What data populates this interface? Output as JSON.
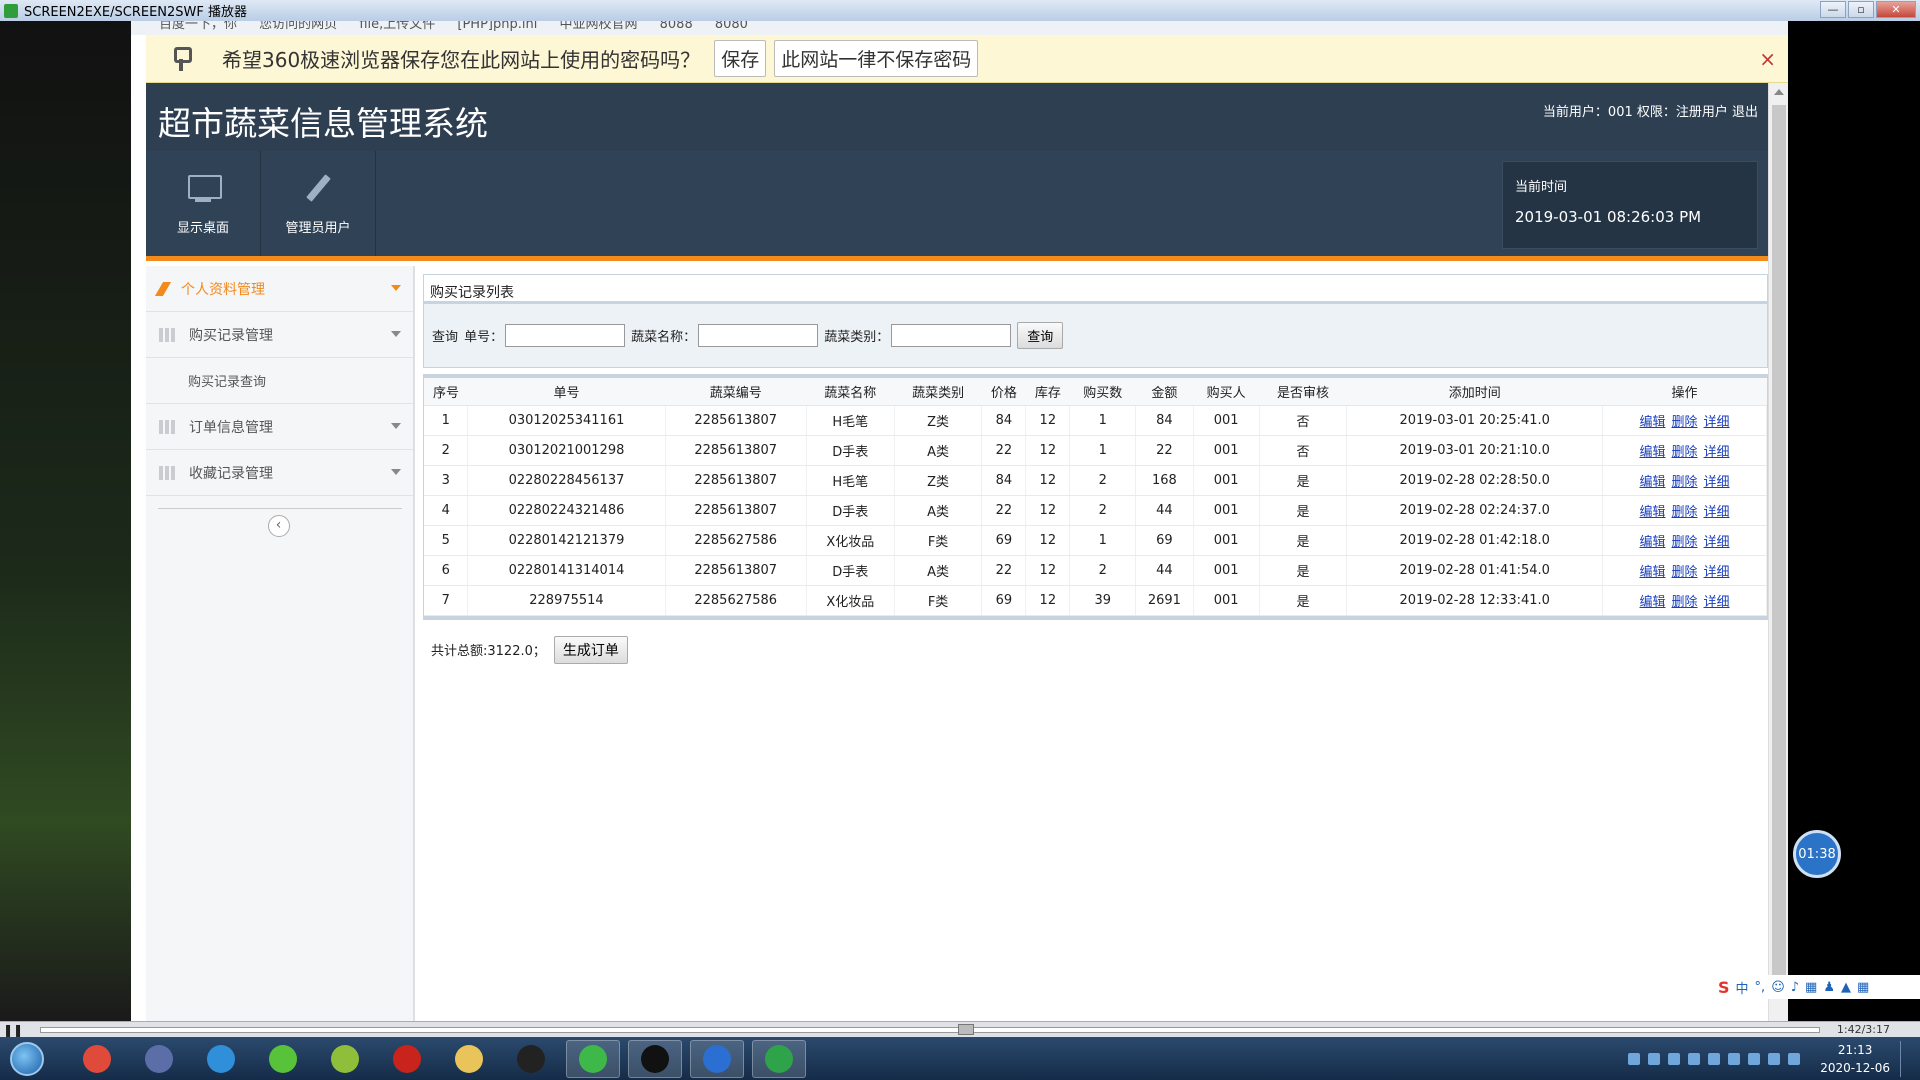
{
  "player": {
    "title": "SCREEN2EXE/SCREEN2SWF 播放器",
    "elapsed": "1:42/3:17",
    "timer_bubble": "01:38"
  },
  "browser": {
    "bookmarks": [
      "百度一下，你",
      "您访问的网页",
      "file,上传文件",
      "[PHP]php.ini",
      "中亚网校官网",
      "8088",
      "8080"
    ],
    "password_bar": {
      "message": "希望360极速浏览器保存您在此网站上使用的密码吗？",
      "save_label": "保存",
      "never_label": "此网站一律不保存密码",
      "close_label": "×"
    }
  },
  "app": {
    "title": "超市蔬菜信息管理系统",
    "user_info": "当前用户：001 权限：注册用户 退出",
    "nav": [
      {
        "label": "显示桌面",
        "icon": "monitor-icon"
      },
      {
        "label": "管理员用户",
        "icon": "pencil-icon"
      }
    ],
    "clock": {
      "label": "当前时间",
      "time": "2019-03-01 08:26:03 PM"
    },
    "accent_color": "#f28a1c",
    "header_color": "#2e3f52"
  },
  "sidebar": {
    "items": [
      {
        "label": "个人资料管理"
      },
      {
        "label": "购买记录管理"
      },
      {
        "label": "订单信息管理"
      },
      {
        "label": "收藏记录管理"
      }
    ],
    "sub_item": "购买记录查询",
    "collapse_glyph": "‹"
  },
  "main": {
    "list_title": "购买记录列表",
    "query": {
      "prefix": "查询",
      "order_label": "单号：",
      "name_label": "蔬菜名称：",
      "category_label": "蔬菜类别：",
      "button": "查询"
    },
    "columns": [
      "序号",
      "单号",
      "蔬菜编号",
      "蔬菜名称",
      "蔬菜类别",
      "价格",
      "库存",
      "购买数",
      "金额",
      "购买人",
      "是否审核",
      "添加时间",
      "操作"
    ],
    "rows": [
      [
        "1",
        "03012025341161",
        "2285613807",
        "H毛笔",
        "Z类",
        "84",
        "12",
        "1",
        "84",
        "001",
        "否",
        "2019-03-01 20:25:41.0"
      ],
      [
        "2",
        "03012021001298",
        "2285613807",
        "D手表",
        "A类",
        "22",
        "12",
        "1",
        "22",
        "001",
        "否",
        "2019-03-01 20:21:10.0"
      ],
      [
        "3",
        "02280228456137",
        "2285613807",
        "H毛笔",
        "Z类",
        "84",
        "12",
        "2",
        "168",
        "001",
        "是",
        "2019-02-28 02:28:50.0"
      ],
      [
        "4",
        "02280224321486",
        "2285613807",
        "D手表",
        "A类",
        "22",
        "12",
        "2",
        "44",
        "001",
        "是",
        "2019-02-28 02:24:37.0"
      ],
      [
        "5",
        "02280142121379",
        "2285627586",
        "X化妆品",
        "F类",
        "69",
        "12",
        "1",
        "69",
        "001",
        "是",
        "2019-02-28 01:42:18.0"
      ],
      [
        "6",
        "02280141314014",
        "2285613807",
        "D手表",
        "A类",
        "22",
        "12",
        "2",
        "44",
        "001",
        "是",
        "2019-02-28 01:41:54.0"
      ],
      [
        "7",
        "228975514",
        "2285627586",
        "X化妆品",
        "F类",
        "69",
        "12",
        "39",
        "2691",
        "001",
        "是",
        "2019-02-28 12:33:41.0"
      ]
    ],
    "actions": [
      "编辑",
      "删除",
      "详细"
    ],
    "total_text": "共计总额:3122.0；",
    "generate_button": "生成订单"
  },
  "ime": {
    "logo": "S",
    "mode": "中"
  },
  "taskbar": {
    "apps": [
      {
        "name": "chrome",
        "color": "#e04a3a"
      },
      {
        "name": "player",
        "color": "#5b6ea8"
      },
      {
        "name": "browser-360",
        "color": "#2f8fd8"
      },
      {
        "name": "leaf",
        "color": "#58c33a"
      },
      {
        "name": "editor",
        "color": "#8fbf3a"
      },
      {
        "name": "flash",
        "color": "#c8241c"
      },
      {
        "name": "explorer",
        "color": "#e8c45a"
      },
      {
        "name": "qq",
        "color": "#222222"
      },
      {
        "name": "wechat",
        "color": "#3fb84a"
      },
      {
        "name": "recorder",
        "color": "#111111"
      },
      {
        "name": "word",
        "color": "#2a6fd1"
      },
      {
        "name": "screen2swf",
        "color": "#2ea34a"
      }
    ],
    "clock_time": "21:13",
    "clock_date": "2020-12-06"
  }
}
